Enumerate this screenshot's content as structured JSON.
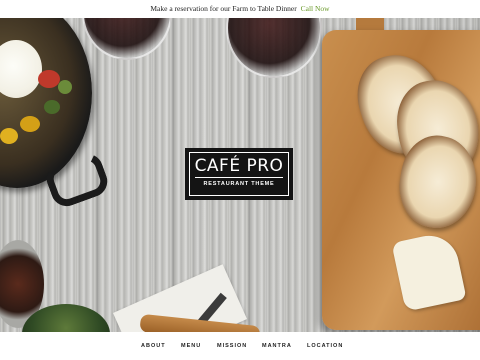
{
  "announcement": {
    "text": "Make a reservation for our Farm to Table Dinner",
    "cta": "Call Now"
  },
  "logo": {
    "title": "CAFÉ PRO",
    "subtitle": "RESTAURANT THEME"
  },
  "nav": {
    "items": [
      "ABOUT",
      "MENU",
      "MISSION",
      "MANTRA",
      "LOCATION"
    ]
  },
  "colors": {
    "cta": "#6a9a2a",
    "logo_bg": "#141414"
  }
}
